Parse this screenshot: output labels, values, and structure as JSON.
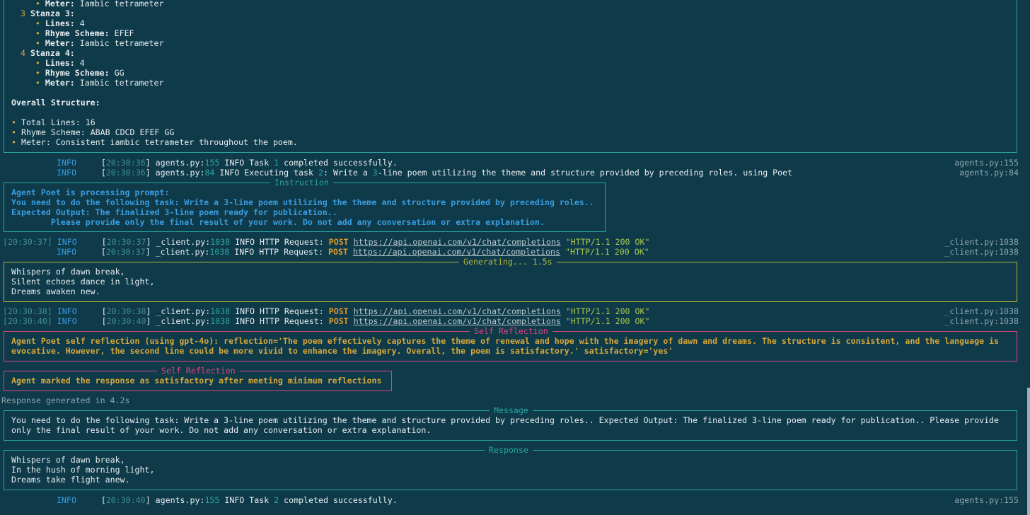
{
  "top_box": {
    "lines": [
      {
        "indent": "    ",
        "bullet": "•",
        "label": "Meter:",
        "value": " Iambic tetrameter"
      },
      {
        "num": " 3",
        "label": "Stanza 3:"
      },
      {
        "indent": "    ",
        "bullet": "•",
        "label": "Lines:",
        "value": " 4"
      },
      {
        "indent": "    ",
        "bullet": "•",
        "label": "Rhyme Scheme:",
        "value": " EFEF"
      },
      {
        "indent": "    ",
        "bullet": "•",
        "label": "Meter:",
        "value": " Iambic tetrameter"
      },
      {
        "num": " 4",
        "label": "Stanza 4:"
      },
      {
        "indent": "    ",
        "bullet": "•",
        "label": "Lines:",
        "value": " 4"
      },
      {
        "indent": "    ",
        "bullet": "•",
        "label": "Rhyme Scheme:",
        "value": " GG"
      },
      {
        "indent": "    ",
        "bullet": "•",
        "label": "Meter:",
        "value": " Iambic tetrameter"
      }
    ],
    "overall_heading": "Overall Structure:",
    "overall_items": [
      "Total Lines: 16",
      "Rhyme Scheme: ABAB CDCD EFEF GG",
      "Meter: Consistent iambic tetrameter throughout the poem."
    ]
  },
  "logs": {
    "l1": {
      "level": "INFO",
      "ts": "20:30:36",
      "file": "agents.py:",
      "line": "155",
      "msg_a": " INFO Task ",
      "num": "1",
      "msg_b": " completed successfully.",
      "right": "agents.py:155"
    },
    "l2": {
      "level": "INFO",
      "ts": "20:30:36",
      "file": "agents.py:",
      "line": "84",
      "msg_a": " INFO Executing task ",
      "num": "2",
      "msg_b": ": Write a ",
      "num2": "3",
      "msg_c": "-line poem utilizing the theme and structure provided by preceding roles. using Poet",
      "right": "agents.py:84"
    },
    "l3": {
      "prefix": "[20:30:37]",
      "level": "INFO",
      "ts": "20:30:37",
      "file": "_client.py:",
      "line": "1038",
      "msg": " INFO HTTP Request: ",
      "method": "POST",
      "url": "https://api.openai.com/v1/chat/completions",
      "status": " \"HTTP/1.1 200 OK\"",
      "right": "_client.py:1038"
    },
    "l4": {
      "level": "INFO",
      "ts": "20:30:37",
      "file": "_client.py:",
      "line": "1038",
      "msg": " INFO HTTP Request: ",
      "method": "POST",
      "url": "https://api.openai.com/v1/chat/completions",
      "status": " \"HTTP/1.1 200 OK\"",
      "right": "_client.py:1038"
    },
    "l5": {
      "prefix": "[20:30:38]",
      "level": "INFO",
      "ts": "20:30:38",
      "file": "_client.py:",
      "line": "1038",
      "msg": " INFO HTTP Request: ",
      "method": "POST",
      "url": "https://api.openai.com/v1/chat/completions",
      "status": " \"HTTP/1.1 200 OK\"",
      "right": "_client.py:1038"
    },
    "l6": {
      "prefix": "[20:30:40]",
      "level": "INFO",
      "ts": "20:30:40",
      "file": "_client.py:",
      "line": "1038",
      "msg": " INFO HTTP Request: ",
      "method": "POST",
      "url": "https://api.openai.com/v1/chat/completions",
      "status": " \"HTTP/1.1 200 OK\"",
      "right": "_client.py:1038"
    },
    "l7": {
      "level": "INFO",
      "ts": "20:30:40",
      "file": "agents.py:",
      "line": "155",
      "msg_a": " INFO Task ",
      "num": "2",
      "msg_b": " completed successfully.",
      "right": "agents.py:155"
    }
  },
  "instruction": {
    "title": "Instruction",
    "lines": [
      "Agent Poet is processing prompt:",
      "You need to do the following task: Write a 3-line poem utilizing the theme and structure provided by preceding roles..",
      "Expected Output: The finalized 3-line poem ready for publication..",
      "        Please provide only the final result of your work. Do not add any conversation or extra explanation."
    ]
  },
  "generating": {
    "title": "Generating... 1.5s",
    "lines": [
      "Whispers of dawn break,",
      "Silent echoes dance in light,",
      "Dreams awaken new."
    ]
  },
  "reflection1": {
    "title": "Self Reflection",
    "lines": [
      "Agent Poet self reflection (using gpt-4o): reflection='The poem effectively captures the theme of renewal and hope with the imagery of dawn and dreams. The structure is consistent, and the language is",
      "evocative. However, the second line could be more vivid to enhance the imagery. Overall, the poem is satisfactory.' satisfactory='yes'"
    ]
  },
  "reflection2": {
    "title": "Self Reflection",
    "line": "Agent marked the response as satisfactory after meeting minimum reflections"
  },
  "response_time": "Response generated in 4.2s",
  "message": {
    "title": "Message",
    "lines": [
      "You need to do the following task: Write a 3-line poem utilizing the theme and structure provided by preceding roles.. Expected Output: The finalized 3-line poem ready for publication.. Please provide",
      "only the final result of your work. Do not add any conversation or extra explanation."
    ]
  },
  "response": {
    "title": "Response",
    "lines": [
      "Whispers of dawn break,",
      "In the hush of morning light,",
      "Dreams take flight anew."
    ]
  },
  "colors": {
    "background": "#0e3a4a",
    "accent_teal": "#2aa6a0",
    "gold": "#d7a83a",
    "pink": "#e0447f",
    "blue": "#3a9de0"
  }
}
